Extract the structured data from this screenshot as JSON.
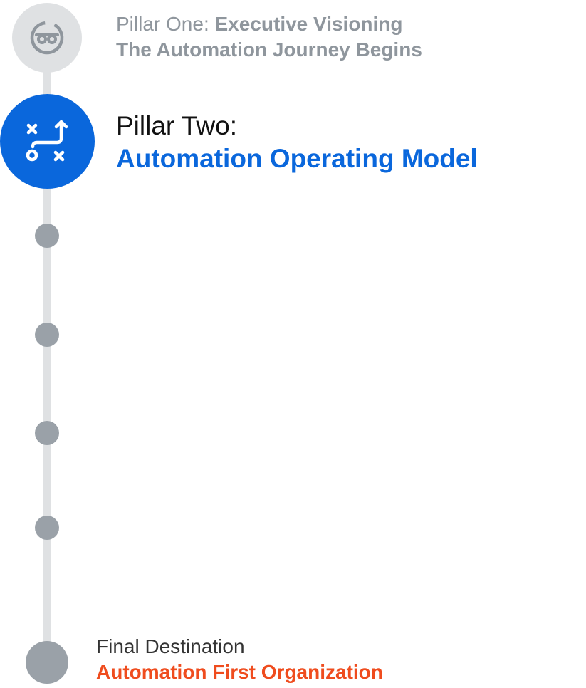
{
  "colors": {
    "track": "#dfe1e3",
    "inactive_text": "#8f969d",
    "active_circle": "#0a67dc",
    "active_title": "#0a67dc",
    "dot": "#9aa1a8",
    "final_title": "#ef4c1e"
  },
  "timeline": {
    "pillar_one": {
      "icon": "glasses-icon",
      "prefix": "Pillar One: ",
      "name": "Executive Visioning",
      "subtitle": "The Automation Journey Begins"
    },
    "pillar_two": {
      "icon": "strategy-play-icon",
      "prefix": "Pillar Two:",
      "name": "Automation Operating Model"
    },
    "final": {
      "prefix": "Final Destination",
      "name": "Automation First Organization"
    }
  }
}
